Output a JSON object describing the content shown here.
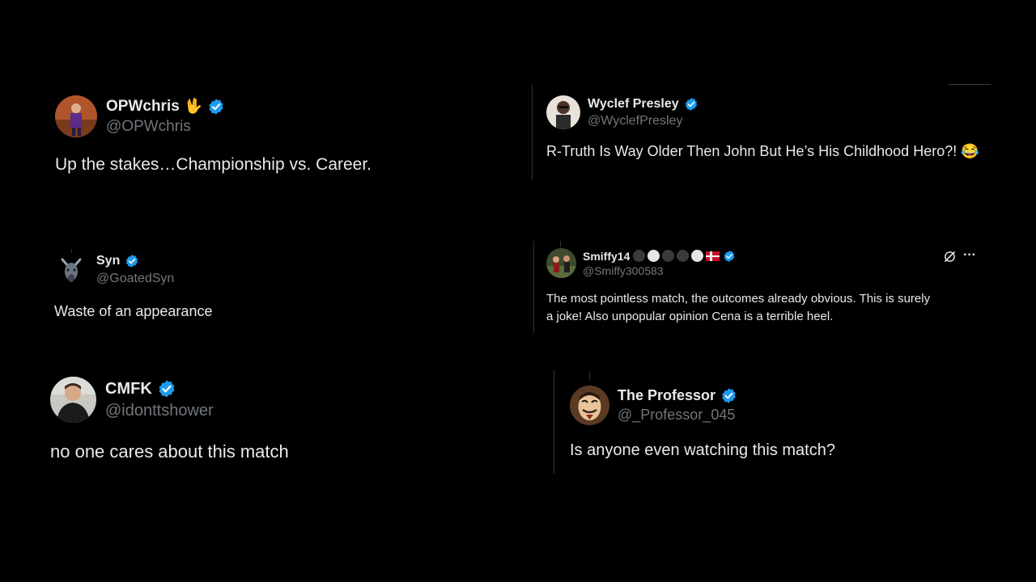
{
  "tweets": {
    "opwchris": {
      "name": "OPWchris",
      "name_emoji": "🖖",
      "handle": "@OPWchris",
      "text": "Up the stakes…Championship vs. Career."
    },
    "wyclef": {
      "name": "Wyclef Presley",
      "handle": "@WyclefPresley",
      "text": "R-Truth Is Way Older Then John But He’s His Childhood Hero?! 😂"
    },
    "syn": {
      "name": "Syn",
      "handle": "@GoatedSyn",
      "text": "Waste of an appearance"
    },
    "smiffy": {
      "name": "Smiffy14",
      "handle": "@Smiffy300583",
      "text_line1": "The most pointless match, the outcomes already obvious. This is surely",
      "text_line2": "a joke! Also unpopular opinion Cena is a terrible heel.",
      "more": "···"
    },
    "cmfk": {
      "name": "CMFK",
      "handle": "@idonttshower",
      "text": "no one cares about this match"
    },
    "professor": {
      "name": "The Professor",
      "handle": "@_Professor_045",
      "text": "Is anyone even watching this match?"
    }
  },
  "colors": {
    "verified": "#1d9bf0",
    "background": "#000000",
    "handle": "#71767b",
    "text": "#e7e9ea"
  },
  "icons": [
    "verified-badge-icon",
    "grok-icon",
    "more-icon"
  ]
}
